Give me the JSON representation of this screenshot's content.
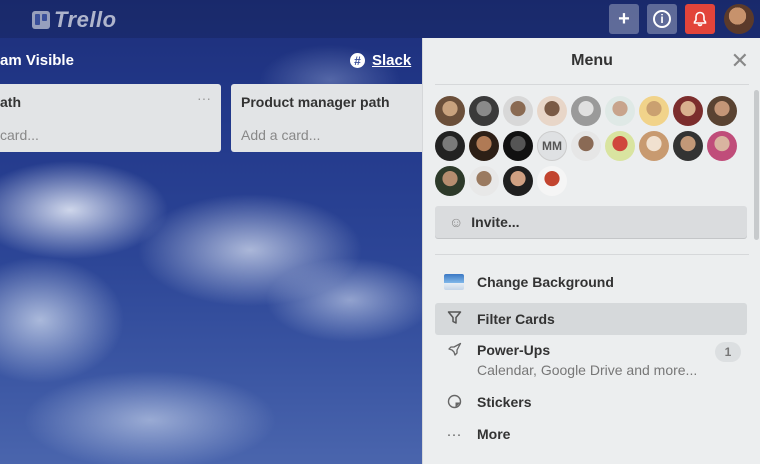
{
  "header": {
    "logo_text": "Trello",
    "add_icon": "plus-icon",
    "info_icon": "info-icon",
    "notification_icon": "bell-icon"
  },
  "board": {
    "visibility_text": "am Visible",
    "slack_label": "Slack",
    "lists": [
      {
        "title": "ath",
        "add_card": "card..."
      },
      {
        "title": "Product manager path",
        "add_card": "Add a card..."
      }
    ]
  },
  "menu": {
    "title": "Menu",
    "close_icon": "close-icon",
    "members": [
      {
        "type": "photo",
        "colors": [
          "#6b4f3a",
          "#c9a27e"
        ]
      },
      {
        "type": "photo",
        "colors": [
          "#3a3a3a",
          "#8a8a8a"
        ]
      },
      {
        "type": "photo",
        "colors": [
          "#d8d8d8",
          "#8a6a52"
        ]
      },
      {
        "type": "photo",
        "colors": [
          "#e8d6c8",
          "#7a5a45"
        ]
      },
      {
        "type": "photo",
        "colors": [
          "#9a9a9a",
          "#e0e0e0"
        ]
      },
      {
        "type": "photo",
        "colors": [
          "#dfe9e6",
          "#c8a48c"
        ]
      },
      {
        "type": "photo",
        "colors": [
          "#f1d38a",
          "#caa070"
        ]
      },
      {
        "type": "photo",
        "colors": [
          "#7c2d2d",
          "#d9b08e"
        ]
      },
      {
        "type": "photo",
        "colors": [
          "#5a4332",
          "#c49677"
        ]
      },
      {
        "type": "photo",
        "colors": [
          "#222222",
          "#7a7a7a"
        ]
      },
      {
        "type": "photo",
        "colors": [
          "#2d1f16",
          "#b07a55"
        ]
      },
      {
        "type": "photo",
        "colors": [
          "#111111",
          "#555555"
        ]
      },
      {
        "type": "initials",
        "text": "MM"
      },
      {
        "type": "photo",
        "colors": [
          "#e6e6e6",
          "#8a6a55"
        ]
      },
      {
        "type": "photo",
        "colors": [
          "#d9e4a0",
          "#d0463c"
        ]
      },
      {
        "type": "photo",
        "colors": [
          "#c89a70",
          "#f1e1d0"
        ]
      },
      {
        "type": "photo",
        "colors": [
          "#333333",
          "#c29878"
        ]
      },
      {
        "type": "photo",
        "colors": [
          "#c04d7a",
          "#d9b4a0"
        ]
      },
      {
        "type": "photo",
        "colors": [
          "#2d3a2a",
          "#b58d6f"
        ]
      },
      {
        "type": "photo",
        "colors": [
          "#e8e8e8",
          "#9a7a60"
        ]
      },
      {
        "type": "photo",
        "colors": [
          "#1f1f1f",
          "#d0a082"
        ]
      },
      {
        "type": "photo",
        "colors": [
          "#f5f5f5",
          "#c2442f"
        ]
      }
    ],
    "invite_label": "Invite...",
    "items": [
      {
        "icon": "background-thumbnail-icon",
        "label": "Change Background"
      },
      {
        "icon": "filter-icon",
        "label": "Filter Cards"
      },
      {
        "icon": "rocket-icon",
        "label": "Power-Ups",
        "sub": "Calendar, Google Drive and more...",
        "badge": "1"
      },
      {
        "icon": "sticker-icon",
        "label": "Stickers"
      },
      {
        "icon": "more-dots-icon",
        "label": "More"
      }
    ]
  }
}
